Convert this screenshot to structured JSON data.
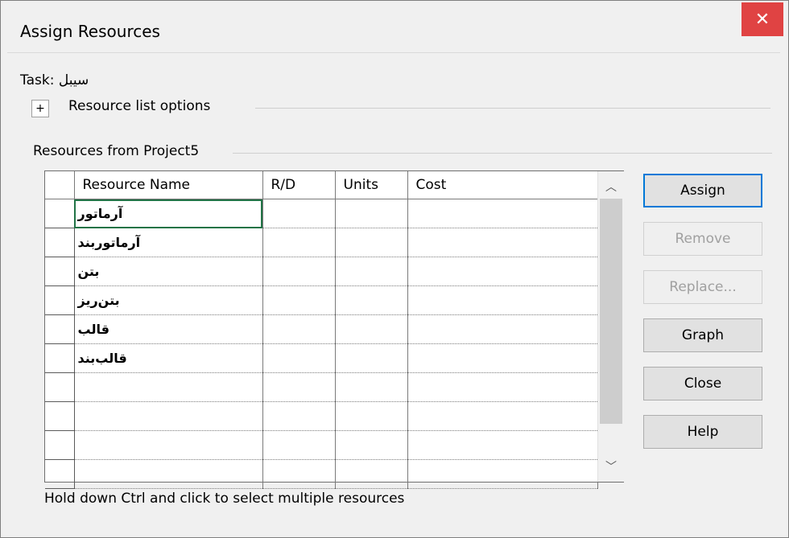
{
  "window": {
    "title": "Assign Resources",
    "close_glyph": "✕"
  },
  "task": {
    "label": "Task: سیبل"
  },
  "options": {
    "toggle_glyph": "+",
    "label": "Resource list options"
  },
  "group": {
    "label": "Resources from Project5"
  },
  "table": {
    "columns": [
      "Resource Name",
      "R/D",
      "Units",
      "Cost"
    ],
    "rows": [
      {
        "name": "آرماتور",
        "rd": "",
        "units": "",
        "cost": ""
      },
      {
        "name": "آرماتوربند",
        "rd": "",
        "units": "",
        "cost": ""
      },
      {
        "name": "بتن",
        "rd": "",
        "units": "",
        "cost": ""
      },
      {
        "name": "بتن‌ریز",
        "rd": "",
        "units": "",
        "cost": ""
      },
      {
        "name": "قالب",
        "rd": "",
        "units": "",
        "cost": ""
      },
      {
        "name": "قالب‌بند",
        "rd": "",
        "units": "",
        "cost": ""
      },
      {
        "name": "",
        "rd": "",
        "units": "",
        "cost": ""
      },
      {
        "name": "",
        "rd": "",
        "units": "",
        "cost": ""
      },
      {
        "name": "",
        "rd": "",
        "units": "",
        "cost": ""
      },
      {
        "name": "",
        "rd": "",
        "units": "",
        "cost": ""
      }
    ],
    "scroll_up_glyph": "︿",
    "scroll_down_glyph": "﹀"
  },
  "buttons": {
    "assign": "Assign",
    "remove": "Remove",
    "replace": "Replace...",
    "graph": "Graph",
    "close": "Close",
    "help": "Help"
  },
  "hint": "Hold down Ctrl and click to select multiple resources",
  "colors": {
    "close_button": "#e04343",
    "selection": "#217346",
    "default_button_border": "#0078d7"
  }
}
